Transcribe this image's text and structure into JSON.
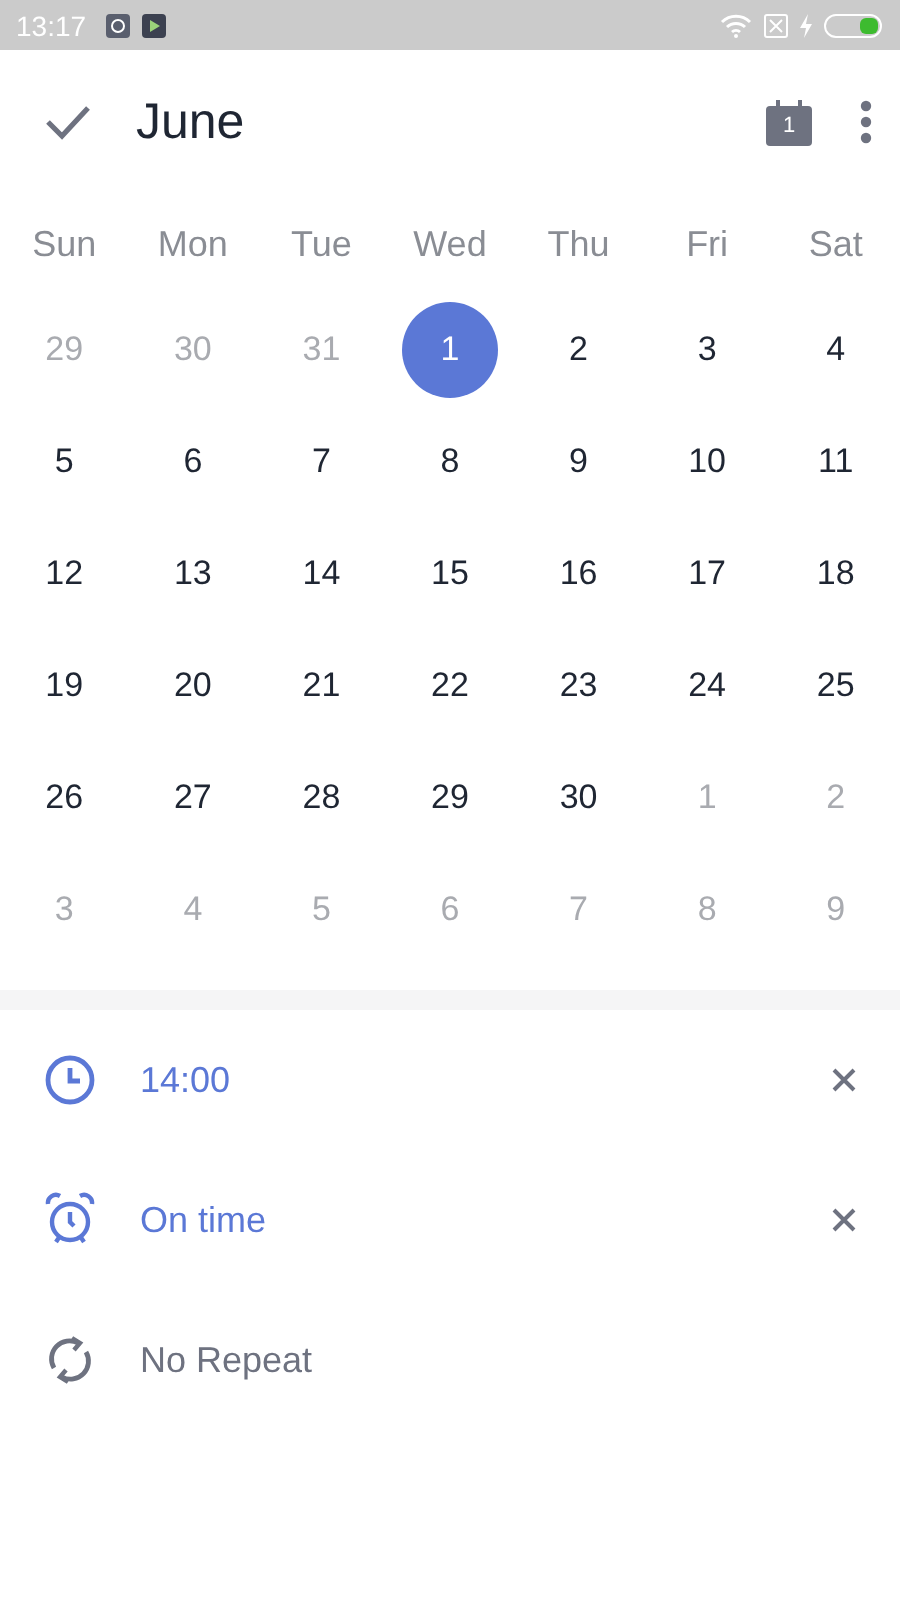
{
  "status_bar": {
    "time": "13:17"
  },
  "header": {
    "title": "June",
    "calendar_badge": "1"
  },
  "weekdays": [
    "Sun",
    "Mon",
    "Tue",
    "Wed",
    "Thu",
    "Fri",
    "Sat"
  ],
  "weeks": [
    [
      {
        "day": "29",
        "in_month": false,
        "selected": false
      },
      {
        "day": "30",
        "in_month": false,
        "selected": false
      },
      {
        "day": "31",
        "in_month": false,
        "selected": false
      },
      {
        "day": "1",
        "in_month": true,
        "selected": true
      },
      {
        "day": "2",
        "in_month": true,
        "selected": false
      },
      {
        "day": "3",
        "in_month": true,
        "selected": false
      },
      {
        "day": "4",
        "in_month": true,
        "selected": false
      }
    ],
    [
      {
        "day": "5",
        "in_month": true,
        "selected": false
      },
      {
        "day": "6",
        "in_month": true,
        "selected": false
      },
      {
        "day": "7",
        "in_month": true,
        "selected": false
      },
      {
        "day": "8",
        "in_month": true,
        "selected": false
      },
      {
        "day": "9",
        "in_month": true,
        "selected": false
      },
      {
        "day": "10",
        "in_month": true,
        "selected": false
      },
      {
        "day": "11",
        "in_month": true,
        "selected": false
      }
    ],
    [
      {
        "day": "12",
        "in_month": true,
        "selected": false
      },
      {
        "day": "13",
        "in_month": true,
        "selected": false
      },
      {
        "day": "14",
        "in_month": true,
        "selected": false
      },
      {
        "day": "15",
        "in_month": true,
        "selected": false
      },
      {
        "day": "16",
        "in_month": true,
        "selected": false
      },
      {
        "day": "17",
        "in_month": true,
        "selected": false
      },
      {
        "day": "18",
        "in_month": true,
        "selected": false
      }
    ],
    [
      {
        "day": "19",
        "in_month": true,
        "selected": false
      },
      {
        "day": "20",
        "in_month": true,
        "selected": false
      },
      {
        "day": "21",
        "in_month": true,
        "selected": false
      },
      {
        "day": "22",
        "in_month": true,
        "selected": false
      },
      {
        "day": "23",
        "in_month": true,
        "selected": false
      },
      {
        "day": "24",
        "in_month": true,
        "selected": false
      },
      {
        "day": "25",
        "in_month": true,
        "selected": false
      }
    ],
    [
      {
        "day": "26",
        "in_month": true,
        "selected": false
      },
      {
        "day": "27",
        "in_month": true,
        "selected": false
      },
      {
        "day": "28",
        "in_month": true,
        "selected": false
      },
      {
        "day": "29",
        "in_month": true,
        "selected": false
      },
      {
        "day": "30",
        "in_month": true,
        "selected": false
      },
      {
        "day": "1",
        "in_month": false,
        "selected": false
      },
      {
        "day": "2",
        "in_month": false,
        "selected": false
      }
    ],
    [
      {
        "day": "3",
        "in_month": false,
        "selected": false
      },
      {
        "day": "4",
        "in_month": false,
        "selected": false
      },
      {
        "day": "5",
        "in_month": false,
        "selected": false
      },
      {
        "day": "6",
        "in_month": false,
        "selected": false
      },
      {
        "day": "7",
        "in_month": false,
        "selected": false
      },
      {
        "day": "8",
        "in_month": false,
        "selected": false
      },
      {
        "day": "9",
        "in_month": false,
        "selected": false
      }
    ]
  ],
  "options": [
    {
      "kind": "time",
      "label": "14:00",
      "set": true
    },
    {
      "kind": "reminder",
      "label": "On time",
      "set": true
    },
    {
      "kind": "repeat",
      "label": "No Repeat",
      "set": false
    }
  ]
}
